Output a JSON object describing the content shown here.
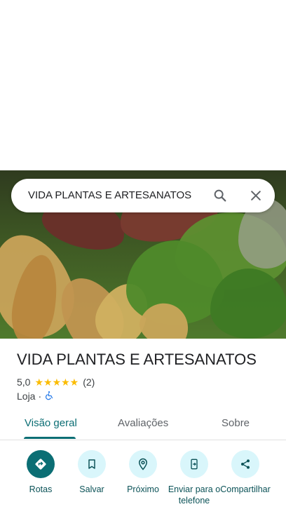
{
  "search": {
    "query": "VIDA PLANTAS E ARTESANATOS"
  },
  "place": {
    "title": "VIDA PLANTAS E ARTESANATOS",
    "rating": "5,0",
    "stars": "★★★★★",
    "review_count": "(2)",
    "category": "Loja",
    "separator": "·"
  },
  "tabs": [
    {
      "label": "Visão geral",
      "active": true
    },
    {
      "label": "Avaliações",
      "active": false
    },
    {
      "label": "Sobre",
      "active": false
    }
  ],
  "actions": [
    {
      "label": "Rotas",
      "icon": "directions-icon"
    },
    {
      "label": "Salvar",
      "icon": "bookmark-icon"
    },
    {
      "label": "Próximo",
      "icon": "nearby-icon"
    },
    {
      "label": "Enviar para o telefone",
      "icon": "send-to-phone-icon"
    },
    {
      "label": "Compartilhar",
      "icon": "share-icon"
    }
  ],
  "colors": {
    "accent": "#0b6e74",
    "star": "#fbbc04",
    "chip": "#d9f6fb",
    "accessible": "#1a73e8"
  }
}
